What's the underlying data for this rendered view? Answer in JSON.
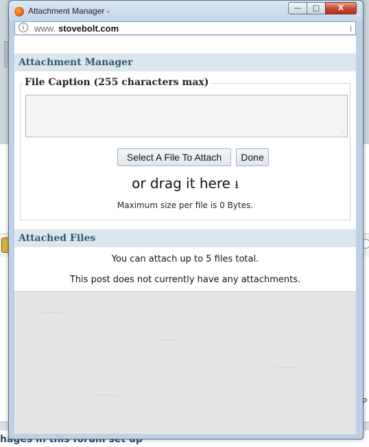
{
  "background": {
    "footer_text": "hages in this forum set up\"",
    "right_text": "P"
  },
  "window": {
    "title": "Attachment Manager -",
    "controls": {
      "minimize": "—",
      "maximize": "□",
      "close": "X"
    }
  },
  "urlbar": {
    "prefix": "www.",
    "host": "stovebolt.com",
    "trailing": "i"
  },
  "attachment_manager": {
    "heading": "Attachment Manager",
    "caption_legend": "File Caption (255 characters max)",
    "caption_value": "",
    "select_button": "Select A File To Attach",
    "done_button": "Done",
    "drag_text": "or drag it here",
    "max_size_text": "Maximum size per file is 0 Bytes."
  },
  "attached_files": {
    "heading": "Attached Files",
    "limit_text": "You can attach up to 5 files total.",
    "status_text": "This post does not currently have any attachments."
  },
  "colors": {
    "section_header_bg": "#dce6ee",
    "section_header_text": "#2e5a74",
    "window_frame": "#bcd1e6",
    "close_button": "#c64530"
  }
}
